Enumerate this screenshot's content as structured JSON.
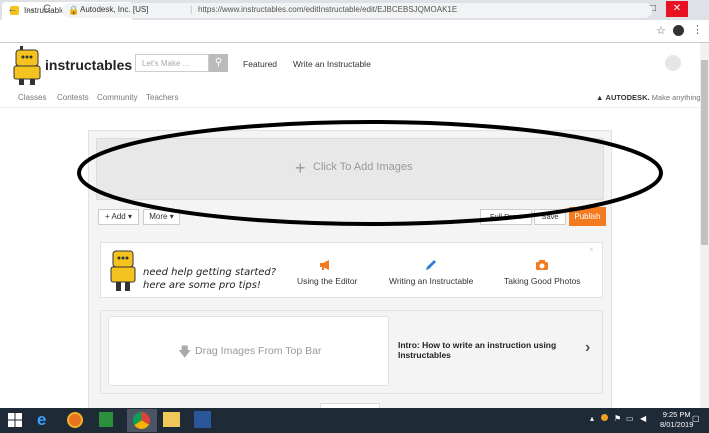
{
  "browser": {
    "tab_title": "Instructable Editor",
    "tab_close": "×",
    "new_tab": "+",
    "url_org": "Autodesk, Inc. [US]",
    "url_separator": "|",
    "url": "https://www.instructables.com/editInstructable/edit/EJBCEBSJQMOAK1E",
    "window_minimize": "–",
    "window_maximize": "□",
    "window_close": "✕"
  },
  "header": {
    "logo_text": "instructables",
    "search_placeholder": "Let's Make ...",
    "nav": [
      "Featured",
      "Write an Instructable"
    ],
    "subnav": [
      "Classes",
      "Contests",
      "Community",
      "Teachers"
    ],
    "autodesk_brand": "AUTODESK.",
    "autodesk_tagline": "Make anything."
  },
  "editor": {
    "add_images_label": "Click To Add Images",
    "add_button": "+ Add ▾",
    "more_button": "More ▾",
    "full_preview_button": "Full Pre...",
    "save_button": "Save",
    "publish_button": "Publish"
  },
  "tips": {
    "close": "×",
    "text_line1": "need help getting started?",
    "text_line2": "here are some pro tips!",
    "items": [
      {
        "label": "Using the Editor",
        "icon": "megaphone-icon",
        "color": "#f37a1f"
      },
      {
        "label": "Writing an Instructable",
        "icon": "pencil-icon",
        "color": "#2a7fd4"
      },
      {
        "label": "Taking Good Photos",
        "icon": "camera-icon",
        "color": "#f37a1f"
      }
    ]
  },
  "step": {
    "drag_label": "Drag Images From Top Bar",
    "title": "Intro: How to write an instruction using Instructables"
  },
  "taskbar": {
    "clock_time": "9:25 PM",
    "clock_date": "8/01/2019"
  },
  "colors": {
    "accent": "#f37a1f",
    "taskbar": "#1f2a37"
  }
}
